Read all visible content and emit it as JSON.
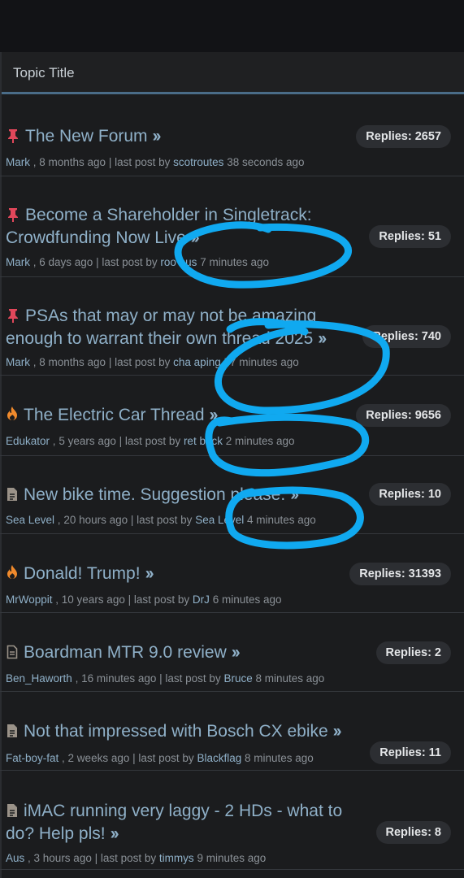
{
  "header": {
    "title": "Topic Title"
  },
  "topics": [
    {
      "icon": "pin-icon",
      "title": "The New Forum",
      "author": "Mark",
      "age": "8 months ago",
      "last_label": "last post by",
      "last_user": "scotroutes",
      "last_time": "38 seconds ago",
      "replies": "Replies: 2657"
    },
    {
      "icon": "pin-icon",
      "title": "Become a Shareholder in Singletrack: Crowdfunding Now Live",
      "author": "Mark",
      "age": "6 days ago",
      "last_label": "last post by",
      "last_user": "roo bus",
      "last_time": "7 minutes ago",
      "replies": "Replies: 51"
    },
    {
      "icon": "pin-icon",
      "title": "PSAs that may or may not be amazing enough to warrant their own thread 2025",
      "author": "Mark",
      "age": "8 months ago",
      "last_label": "last post by",
      "last_user": "cha aping",
      "last_time": "57 minutes ago",
      "replies": "Replies: 740"
    },
    {
      "icon": "fire-icon",
      "title": "The Electric Car Thread",
      "author": "Edukator",
      "age": "5 years ago",
      "last_label": "last post by",
      "last_user": "ret brick",
      "last_time": "2 minutes ago",
      "replies": "Replies: 9656"
    },
    {
      "icon": "document-icon",
      "title": "New bike time. Suggestion please.",
      "author": "Sea Level",
      "age": "20 hours ago",
      "last_label": "last post by",
      "last_user": "Sea Level",
      "last_time": "4 minutes ago",
      "replies": "Replies: 10"
    },
    {
      "icon": "fire-icon",
      "title": "Donald! Trump!",
      "author": "MrWoppit",
      "age": "10 years ago",
      "last_label": "last post by",
      "last_user": "DrJ",
      "last_time": "6 minutes ago",
      "replies": "Replies: 31393"
    },
    {
      "icon": "document-outline-icon",
      "title": "Boardman MTR 9.0 review",
      "author": "Ben_Haworth",
      "age": "16 minutes ago",
      "last_label": "last post by",
      "last_user": "Bruce",
      "last_time": "8 minutes ago",
      "replies": "Replies: 2"
    },
    {
      "icon": "document-icon",
      "title": "Not that impressed with Bosch CX ebike",
      "author": "Fat-boy-fat",
      "age": "2 weeks ago",
      "last_label": "last post by",
      "last_user": "Blackflag",
      "last_time": "8 minutes ago",
      "replies": "Replies: 11"
    },
    {
      "icon": "document-icon",
      "title": "iMAC running very laggy - 2 HDs - what to do? Help pls!",
      "author": "Aus",
      "age": "3 hours ago",
      "last_label": "last post by",
      "last_user": "timmys",
      "last_time": "9 minutes ago",
      "replies": "Replies: 8"
    }
  ],
  "colors": {
    "link": "#8fb0c8",
    "meta": "#8a9096",
    "pin": "#e0475a",
    "fire": "#f08a2c",
    "scribble": "#10a9f0",
    "divider": "#4a6c88"
  }
}
